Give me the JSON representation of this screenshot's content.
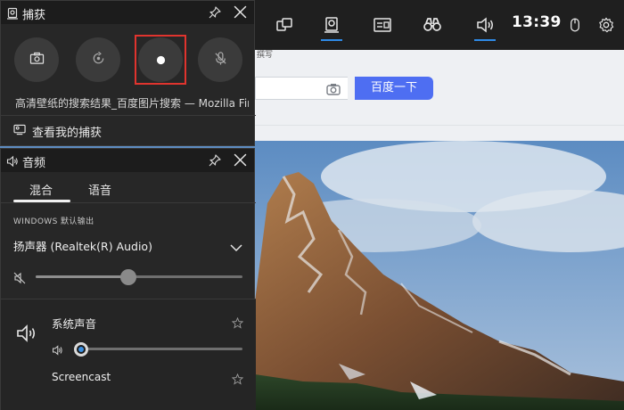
{
  "browser": {
    "strip_text": "撰写",
    "search_button": "百度一下",
    "search_icon": "camera-icon"
  },
  "topbar": {
    "buttons": [
      {
        "icon": "multi-window-icon",
        "active": false
      },
      {
        "icon": "capture-icon",
        "active": true
      },
      {
        "icon": "performance-icon",
        "active": false
      },
      {
        "icon": "binoculars-icon",
        "active": false
      },
      {
        "icon": "speaker-icon",
        "active": true
      }
    ],
    "time": "13:39",
    "mouse_icon": "mouse-icon",
    "settings_icon": "gear-icon",
    "accent": "#2f8ae6"
  },
  "capture_panel": {
    "title": "捕获",
    "buttons": [
      {
        "name": "screenshot-button",
        "icon": "camera-icon"
      },
      {
        "name": "record-last-button",
        "icon": "replay-icon"
      },
      {
        "name": "start-recording-button",
        "icon": "record-dot-icon"
      },
      {
        "name": "mic-toggle-button",
        "icon": "mic-off-icon"
      }
    ],
    "highlight_color": "#e0342e",
    "source": "高清壁纸的搜索结果_百度图片搜索 — Mozilla Firefox",
    "view_captures": "查看我的捕获"
  },
  "audio_panel": {
    "title": "音频",
    "tabs": [
      {
        "label": "混合",
        "active": true
      },
      {
        "label": "语音",
        "active": false
      }
    ],
    "output_label": "WINDOWS 默认输出",
    "device": "扬声器 (Realtek(R) Audio)",
    "master_volume": 0.45,
    "apps": [
      {
        "name": "系统声音",
        "volume": 0.0
      },
      {
        "name": "Screencast",
        "volume": null
      }
    ]
  }
}
